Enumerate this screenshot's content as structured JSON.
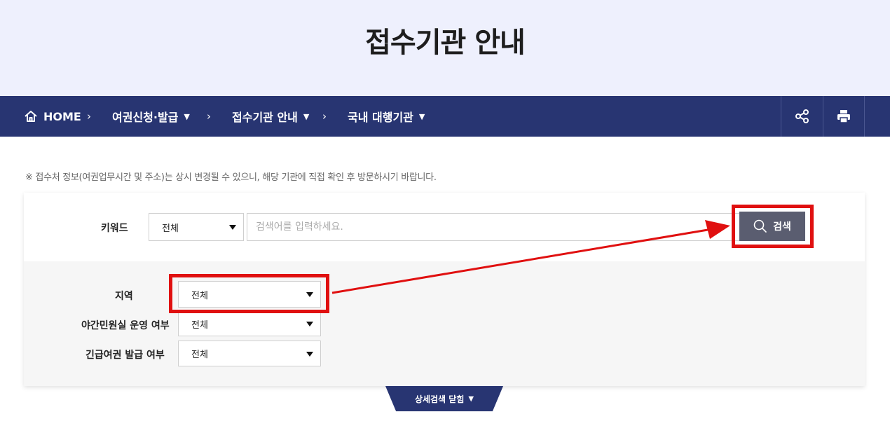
{
  "page_title": "접수기관 안내",
  "breadcrumb": {
    "home_label": "HOME",
    "items": [
      {
        "label": "여권신청·발급"
      },
      {
        "label": "접수기관 안내"
      },
      {
        "label": "국내 대행기관"
      }
    ]
  },
  "actions": {
    "share_icon": "share-icon",
    "print_icon": "print-icon"
  },
  "notice": "※ 접수처 정보(여권업무시간 및 주소)는 상시 변경될 수 있으니, 해당 기관에 직접 확인 후 방문하시기 바랍니다.",
  "search": {
    "keyword_label": "키워드",
    "keyword_scope_value": "전체",
    "placeholder": "검색어를 입력하세요.",
    "button_label": "검색"
  },
  "filters": [
    {
      "label": "지역",
      "value": "전체"
    },
    {
      "label": "야간민원실 운영 여부",
      "value": "전체"
    },
    {
      "label": "긴급여권 발급 여부",
      "value": "전체"
    }
  ],
  "detail_toggle_label": "상세검색 닫힘",
  "colors": {
    "navy": "#283572",
    "hero_bg": "#eef0fd",
    "highlight": "#e01010",
    "search_button": "#5a5d70"
  }
}
